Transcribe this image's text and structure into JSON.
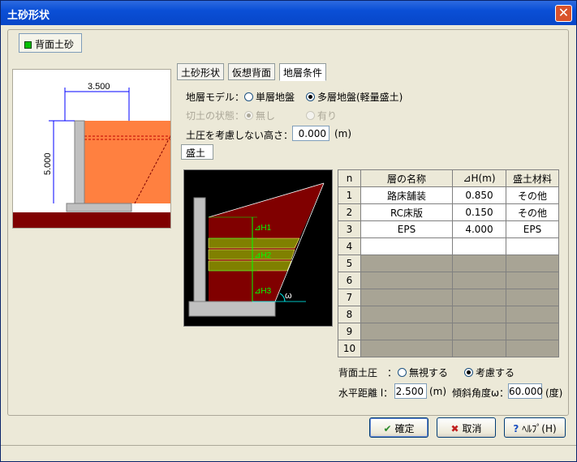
{
  "window": {
    "title": "土砂形状"
  },
  "toggle": {
    "label": "背面土砂"
  },
  "preview": {
    "width_dim": "3.500",
    "height_dim": "5.000"
  },
  "tabs": [
    {
      "label": "土砂形状"
    },
    {
      "label": "仮想背面"
    },
    {
      "label": "地層条件"
    }
  ],
  "form": {
    "model_label": "地層モデル：",
    "model_opt1": "単層地盤",
    "model_opt2": "多層地盤(軽量盛土)",
    "cut_label": "切土の状態：",
    "cut_opt1": "無し",
    "cut_opt2": "有り",
    "ignore_height_label": "土圧を考慮しない高さ：",
    "ignore_height_value": "0.000",
    "ignore_height_unit": "(m)"
  },
  "subtab": {
    "label": "盛土"
  },
  "diagram": {
    "h1": "⊿H1",
    "h2": "⊿H2",
    "h3": "⊿H3",
    "omega": "ω"
  },
  "table": {
    "headers": [
      "n",
      "層の名称",
      "⊿H(m)",
      "盛土材料"
    ],
    "rows": [
      {
        "n": "1",
        "name": "路床舗装",
        "dh": "0.850",
        "mat": "その他"
      },
      {
        "n": "2",
        "name": "RC床版",
        "dh": "0.150",
        "mat": "その他"
      },
      {
        "n": "3",
        "name": "EPS",
        "dh": "4.000",
        "mat": "EPS"
      },
      {
        "n": "4",
        "name": "",
        "dh": "",
        "mat": ""
      },
      {
        "n": "5",
        "name": "",
        "dh": "",
        "mat": ""
      },
      {
        "n": "6",
        "name": "",
        "dh": "",
        "mat": ""
      },
      {
        "n": "7",
        "name": "",
        "dh": "",
        "mat": ""
      },
      {
        "n": "8",
        "name": "",
        "dh": "",
        "mat": ""
      },
      {
        "n": "9",
        "name": "",
        "dh": "",
        "mat": ""
      },
      {
        "n": "10",
        "name": "",
        "dh": "",
        "mat": ""
      }
    ]
  },
  "back_pressure": {
    "label": "背面土圧　：",
    "opt1": "無視する",
    "opt2": "考慮する"
  },
  "horizontal": {
    "label": "水平距離 l：",
    "value": "2.500",
    "unit": "(m)"
  },
  "angle": {
    "label": "傾斜角度ω：",
    "value": "60.000",
    "unit": "(度)"
  },
  "buttons": {
    "ok": "確定",
    "cancel": "取消",
    "help": "ﾍﾙﾌﾟ(H)"
  },
  "colors": {
    "fill_orange": "#ff8040",
    "fill_maroon": "#800000",
    "fill_olive": "#808000",
    "wall_gray": "#c0c0c0",
    "dim_blue": "#0000ff"
  }
}
